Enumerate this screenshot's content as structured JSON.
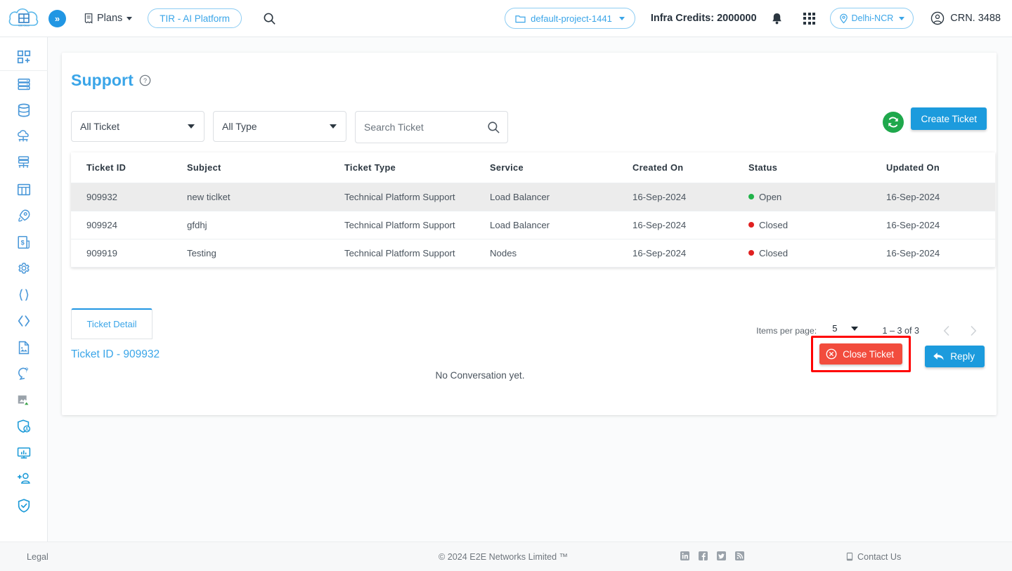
{
  "header": {
    "logo_name": "e2e-cloud-logo",
    "expand_label": "»",
    "plans_label": "Plans",
    "tir_pill": "TIR - AI Platform",
    "search_icon": "search-icon",
    "project_selector": "default-project-1441",
    "credits_label": "Infra Credits: 2000000",
    "bell_icon": "notification-bell-icon",
    "apps_icon": "apps-grid-icon",
    "region": "Delhi-NCR",
    "account_label": "CRN. 3488"
  },
  "sidebar": {
    "items": [
      {
        "icon": "add-grid-icon",
        "name": "sidebar-item-dashboard"
      },
      {
        "icon": "server-rack-icon",
        "name": "sidebar-item-compute"
      },
      {
        "icon": "database-icon",
        "name": "sidebar-item-database"
      },
      {
        "icon": "cloud-network-icon",
        "name": "sidebar-item-cloud"
      },
      {
        "icon": "server-network-icon",
        "name": "sidebar-item-network"
      },
      {
        "icon": "storage-grid-icon",
        "name": "sidebar-item-storage"
      },
      {
        "icon": "rocket-icon",
        "name": "sidebar-item-launch"
      },
      {
        "icon": "billing-invoice-icon",
        "name": "sidebar-item-billing"
      },
      {
        "icon": "gear-icon",
        "name": "sidebar-item-settings"
      },
      {
        "icon": "curly-braces-icon",
        "name": "sidebar-item-api"
      },
      {
        "icon": "angle-brackets-icon",
        "name": "sidebar-item-code"
      },
      {
        "icon": "document-icon",
        "name": "sidebar-item-docs"
      },
      {
        "icon": "support-chat-icon",
        "name": "sidebar-item-support"
      },
      {
        "icon": "image-icon",
        "name": "sidebar-item-images"
      },
      {
        "icon": "shield-user-icon",
        "name": "sidebar-item-security"
      },
      {
        "icon": "monitor-chart-icon",
        "name": "sidebar-item-monitoring"
      },
      {
        "icon": "add-user-icon",
        "name": "sidebar-item-users"
      },
      {
        "icon": "shield-check-icon",
        "name": "sidebar-item-compliance"
      }
    ]
  },
  "main": {
    "title": "Support",
    "help_icon": "help-circle-icon",
    "filters": {
      "ticket_filter": "All Ticket",
      "type_filter": "All Type",
      "search_placeholder": "Search Ticket",
      "search_value": "",
      "search_icon": "search-icon"
    },
    "refresh_icon": "refresh-icon",
    "create_ticket_label": "Create Ticket",
    "table": {
      "columns": [
        "Ticket ID",
        "Subject",
        "Ticket Type",
        "Service",
        "Created On",
        "Status",
        "Updated On"
      ],
      "rows": [
        {
          "ticket_id": "909932",
          "subject": "new ticlket",
          "ticket_type": "Technical Platform Support",
          "service": "Load Balancer",
          "created_on": "16-Sep-2024",
          "status": "Open",
          "status_color": "#21b34a",
          "updated_on": "16-Sep-2024",
          "selected": true
        },
        {
          "ticket_id": "909924",
          "subject": "gfdhj",
          "ticket_type": "Technical Platform Support",
          "service": "Load Balancer",
          "created_on": "16-Sep-2024",
          "status": "Closed",
          "status_color": "#e02020",
          "updated_on": "16-Sep-2024",
          "selected": false
        },
        {
          "ticket_id": "909919",
          "subject": "Testing",
          "ticket_type": "Technical Platform Support",
          "service": "Nodes",
          "created_on": "16-Sep-2024",
          "status": "Closed",
          "status_color": "#e02020",
          "updated_on": "16-Sep-2024",
          "selected": false
        }
      ]
    },
    "paginator": {
      "items_per_page_label": "Items per page:",
      "items_per_page_value": "5",
      "range_label": "1 – 3 of 3",
      "prev_icon": "chevron-left-icon",
      "next_icon": "chevron-right-icon"
    },
    "detail": {
      "tab_label": "Ticket Detail",
      "ticket_id_label": "Ticket ID - 909932",
      "empty_message": "No Conversation yet.",
      "close_ticket_label": "Close Ticket",
      "close_ticket_icon": "close-circle-icon",
      "reply_label": "Reply",
      "reply_icon": "reply-arrow-icon",
      "highlight_color": "#ff0000"
    }
  },
  "footer": {
    "legal": "Legal",
    "copyright_prefix": "© 2024 ",
    "company": "E2E Networks Limited ™",
    "social": [
      "linkedin-icon",
      "facebook-icon",
      "twitter-icon",
      "rss-icon"
    ],
    "contact_label": "Contact Us",
    "contact_icon": "phone-icon"
  },
  "colors": {
    "accent": "#3aa5e8",
    "primary_button": "#1c9bdd",
    "danger": "#f24c3d",
    "success": "#1fa84c",
    "page_bg": "#fafbfc"
  }
}
